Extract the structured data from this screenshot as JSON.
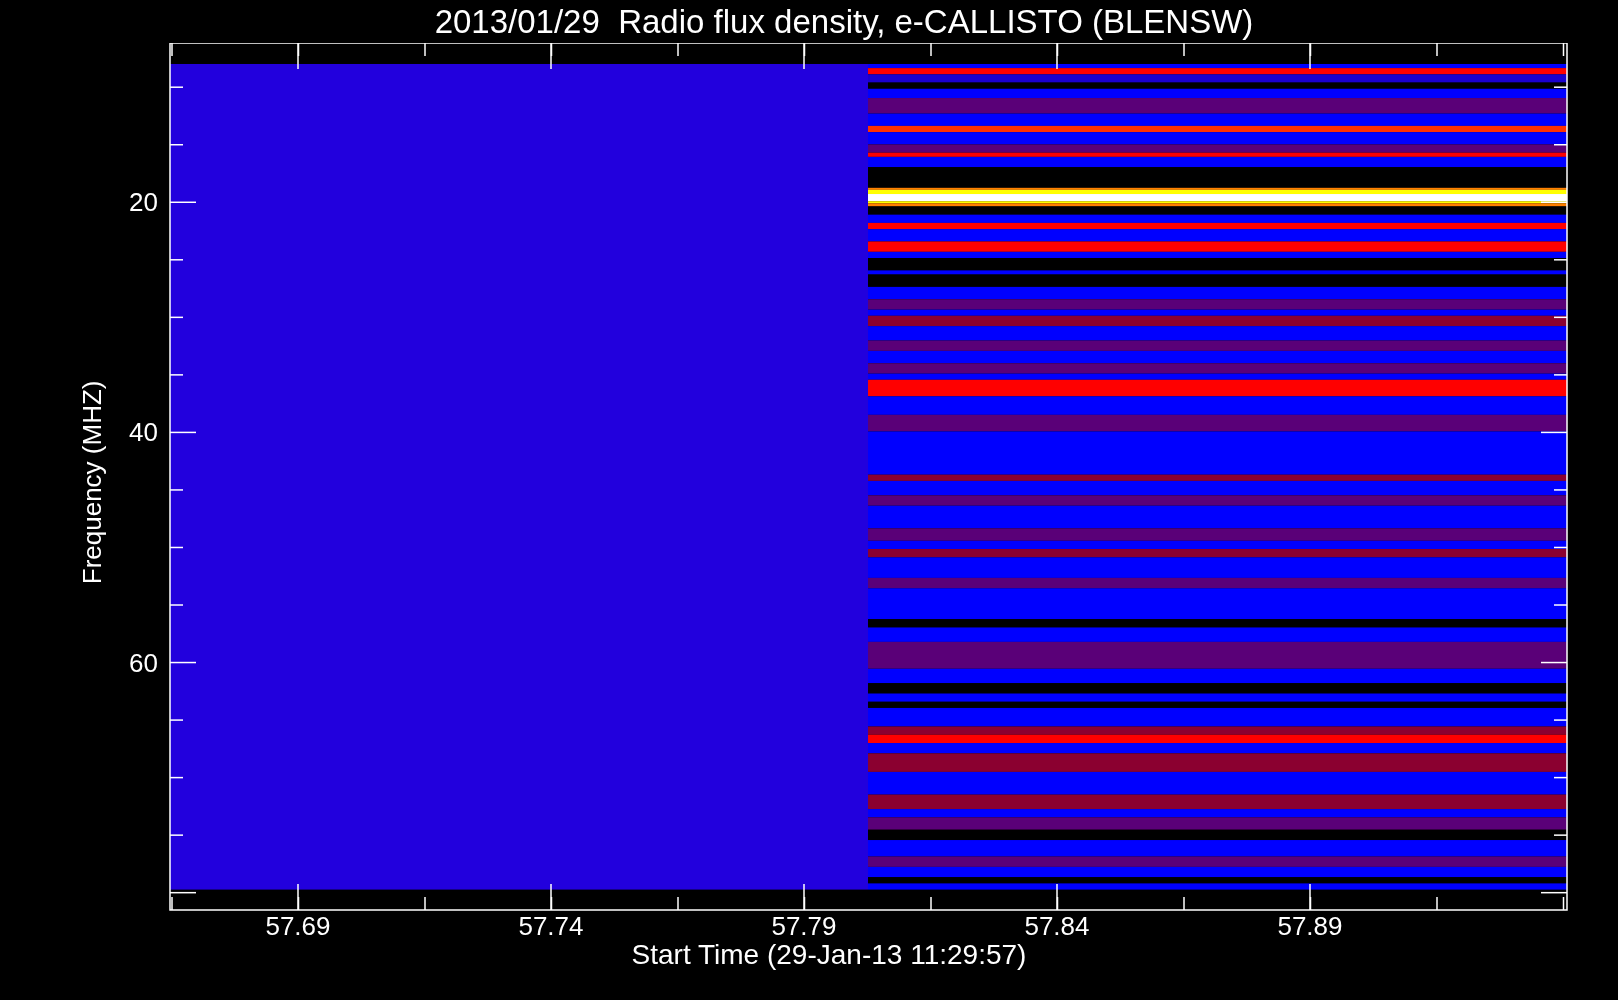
{
  "title": "2013/01/29  Radio flux density, e-CALLISTO (BLENSW)",
  "y_axis": {
    "label": "Frequency (MHZ)",
    "ticks": [
      "20",
      "40",
      "60"
    ]
  },
  "x_axis": {
    "label": "Start Time (29-Jan-13 11:29:57)",
    "ticks": [
      "57.69",
      "57.74",
      "57.79",
      "57.84",
      "57.89"
    ]
  }
}
